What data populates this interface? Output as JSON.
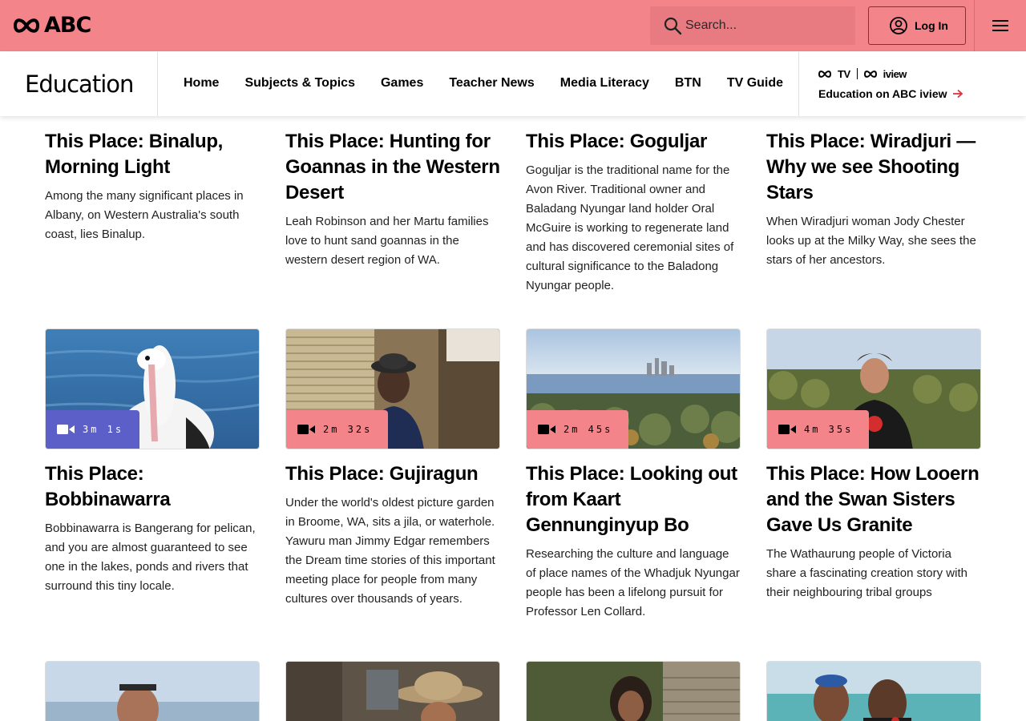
{
  "header": {
    "logo_text": "ABC",
    "search_placeholder": "Search...",
    "login_label": "Log In",
    "colors": {
      "bar": "#f2848a",
      "search": "#e87b81",
      "video_badge": "#f2848a",
      "video_badge_active": "#5b5fc7"
    }
  },
  "subnav": {
    "title": "Education",
    "links": [
      "Home",
      "Subjects & Topics",
      "Games",
      "Teacher News",
      "Media Literacy",
      "BTN",
      "TV Guide"
    ],
    "promo": {
      "tv_word": "TV",
      "iview_word": "iview",
      "link": "Education on ABC iview"
    }
  },
  "cards_row1": [
    {
      "title": "This Place: Binalup, Morning Light",
      "desc": "Among the many significant places in Albany, on Western Australia's south coast, lies Binalup."
    },
    {
      "title": "This Place: Hunting for Goannas in the Western Desert",
      "desc": "Leah Robinson and her Martu families love to hunt sand goannas in the western desert region of WA."
    },
    {
      "title": "This Place: Goguljar",
      "desc": "Goguljar is the traditional name for the Avon River. Traditional owner and Baladang Nyungar land holder Oral McGuire is working to regenerate land and has discovered ceremonial sites of cultural significance to the Baladong Nyungar people."
    },
    {
      "title": "This Place: Wiradjuri — Why we see Shooting Stars",
      "desc": "When Wiradjuri woman Jody Chester looks up at the Milky Way, she sees the stars of her ancestors."
    }
  ],
  "cards_row2": [
    {
      "title": "This Place: Bobbinawarra",
      "desc": "Bobbinawarra is Bangerang for pelican, and you are almost guaranteed to see one in the lakes, ponds and rivers that surround this tiny locale.",
      "duration": "3m 1s",
      "thumb_icon": "pelican-image"
    },
    {
      "title": "This Place: Gujiragun",
      "desc": "Under the world's oldest picture garden in Broome, WA, sits a jila, or waterhole. Yawuru man Jimmy Edgar remembers the Dream time stories of this important meeting place for people from many cultures over thousands of years.",
      "duration": "2m 32s",
      "thumb_icon": "man-portrait-image"
    },
    {
      "title": "This Place: Looking out from Kaart Gennunginyup Bo",
      "desc": "Researching the culture and language of place names of the Whadjuk Nyungar people has been a lifelong pursuit for Professor Len Collard.",
      "duration": "2m 45s",
      "thumb_icon": "city-river-view-image"
    },
    {
      "title": "This Place: How Looern and the Swan Sisters Gave Us Granite",
      "desc": "The Wathaurung people of Victoria share a fascinating creation story with their neighbouring tribal groups",
      "duration": "4m 35s",
      "thumb_icon": "man-in-forest-image"
    }
  ]
}
